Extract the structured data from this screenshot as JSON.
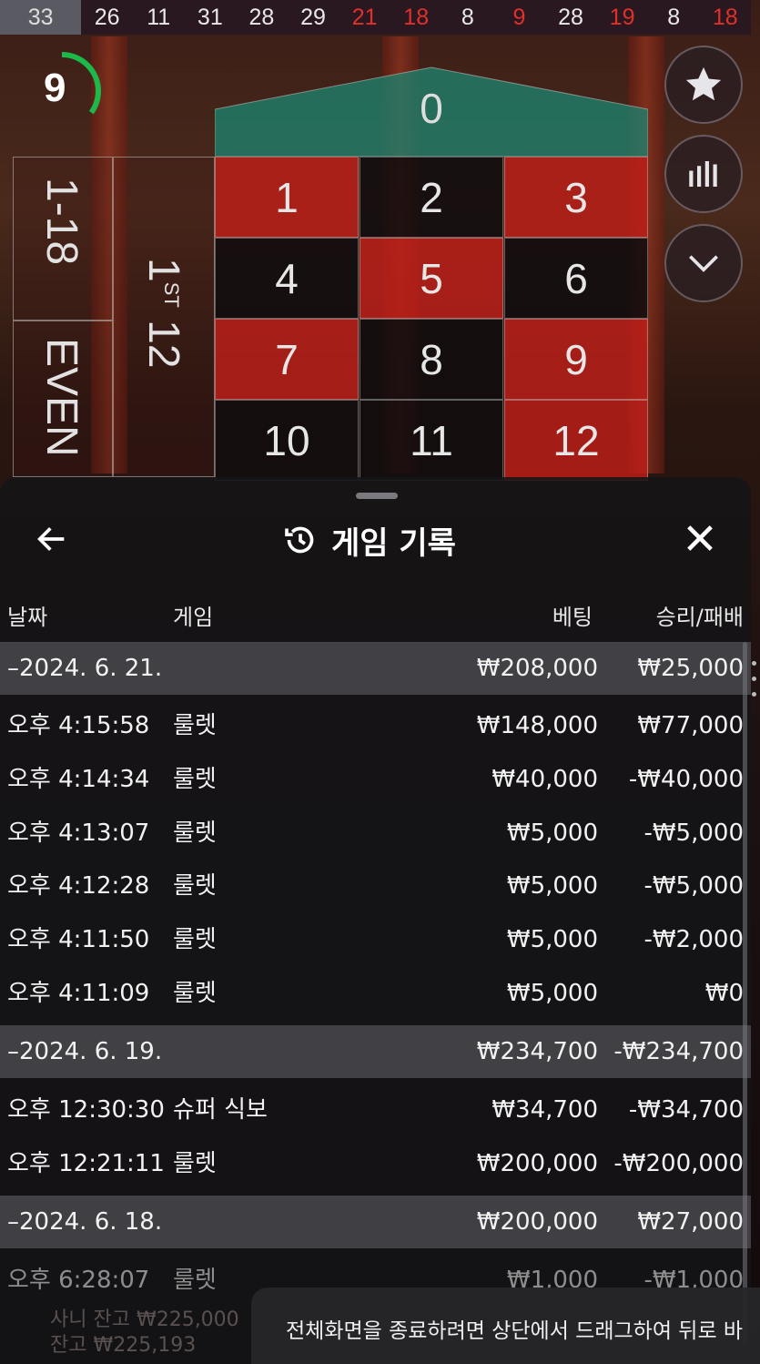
{
  "history": {
    "numbers": [
      {
        "v": "33",
        "c": "latest"
      },
      {
        "v": "26",
        "c": "black"
      },
      {
        "v": "11",
        "c": "black"
      },
      {
        "v": "31",
        "c": "black"
      },
      {
        "v": "28",
        "c": "black"
      },
      {
        "v": "29",
        "c": "black"
      },
      {
        "v": "21",
        "c": "red"
      },
      {
        "v": "18",
        "c": "red"
      },
      {
        "v": "8",
        "c": "black"
      },
      {
        "v": "9",
        "c": "red"
      },
      {
        "v": "28",
        "c": "black"
      },
      {
        "v": "19",
        "c": "red"
      },
      {
        "v": "8",
        "c": "black"
      },
      {
        "v": "18",
        "c": "red"
      }
    ]
  },
  "timer": {
    "value": "9",
    "fraction": 0.35,
    "color": "#1db84a"
  },
  "side_buttons": [
    {
      "icon": "star-icon"
    },
    {
      "icon": "statistics-icon"
    },
    {
      "icon": "chevron-down-icon"
    }
  ],
  "table": {
    "zero": "0",
    "cells": [
      {
        "n": "1",
        "c": "red"
      },
      {
        "n": "2",
        "c": "black"
      },
      {
        "n": "3",
        "c": "red"
      },
      {
        "n": "4",
        "c": "black"
      },
      {
        "n": "5",
        "c": "red"
      },
      {
        "n": "6",
        "c": "black"
      },
      {
        "n": "7",
        "c": "red"
      },
      {
        "n": "8",
        "c": "black"
      },
      {
        "n": "9",
        "c": "red"
      },
      {
        "n": "10",
        "c": "black"
      },
      {
        "n": "11",
        "c": "black"
      },
      {
        "n": "12",
        "c": "red"
      }
    ],
    "outside_1_18": "1-18",
    "outside_even": "EVEN",
    "dozen_num": "1",
    "dozen_sup": "ST",
    "dozen_rest": "12"
  },
  "panel": {
    "title": "게임 기록",
    "columns": {
      "date": "날짜",
      "game": "게임",
      "bet": "베팅",
      "result": "승리/패배"
    },
    "rows": [
      {
        "type": "group",
        "date": "–2024. 6. 21.",
        "game": "",
        "bet": "₩208,000",
        "result": "₩25,000"
      },
      {
        "type": "item",
        "date": "오후 4:15:58",
        "game": "룰렛",
        "bet": "₩148,000",
        "result": "₩77,000"
      },
      {
        "type": "item",
        "date": "오후 4:14:34",
        "game": "룰렛",
        "bet": "₩40,000",
        "result": "-₩40,000"
      },
      {
        "type": "item",
        "date": "오후 4:13:07",
        "game": "룰렛",
        "bet": "₩5,000",
        "result": "-₩5,000"
      },
      {
        "type": "item",
        "date": "오후 4:12:28",
        "game": "룰렛",
        "bet": "₩5,000",
        "result": "-₩5,000"
      },
      {
        "type": "item",
        "date": "오후 4:11:50",
        "game": "룰렛",
        "bet": "₩5,000",
        "result": "-₩2,000"
      },
      {
        "type": "item",
        "date": "오후 4:11:09",
        "game": "룰렛",
        "bet": "₩5,000",
        "result": "₩0"
      },
      {
        "type": "group",
        "date": "–2024. 6. 19.",
        "game": "",
        "bet": "₩234,700",
        "result": "-₩234,700"
      },
      {
        "type": "item",
        "date": "오후 12:30:30",
        "game": "슈퍼 식보",
        "bet": "₩34,700",
        "result": "-₩34,700"
      },
      {
        "type": "item",
        "date": "오후 12:21:11",
        "game": "룰렛",
        "bet": "₩200,000",
        "result": "-₩200,000"
      },
      {
        "type": "group",
        "date": "–2024. 6. 18.",
        "game": "",
        "bet": "₩200,000",
        "result": "₩27,000"
      },
      {
        "type": "faded",
        "date": "오후 6:28:07",
        "game": "룰렛",
        "bet": "₩1,000",
        "result": "-₩1,000"
      }
    ]
  },
  "balance_ghost": {
    "line1": "사니 잔고 ₩225,000",
    "line2": "잔고 ₩225,193"
  },
  "toast": {
    "text": "전체화면을 종료하려면 상단에서 드래그하여 뒤로 바"
  }
}
